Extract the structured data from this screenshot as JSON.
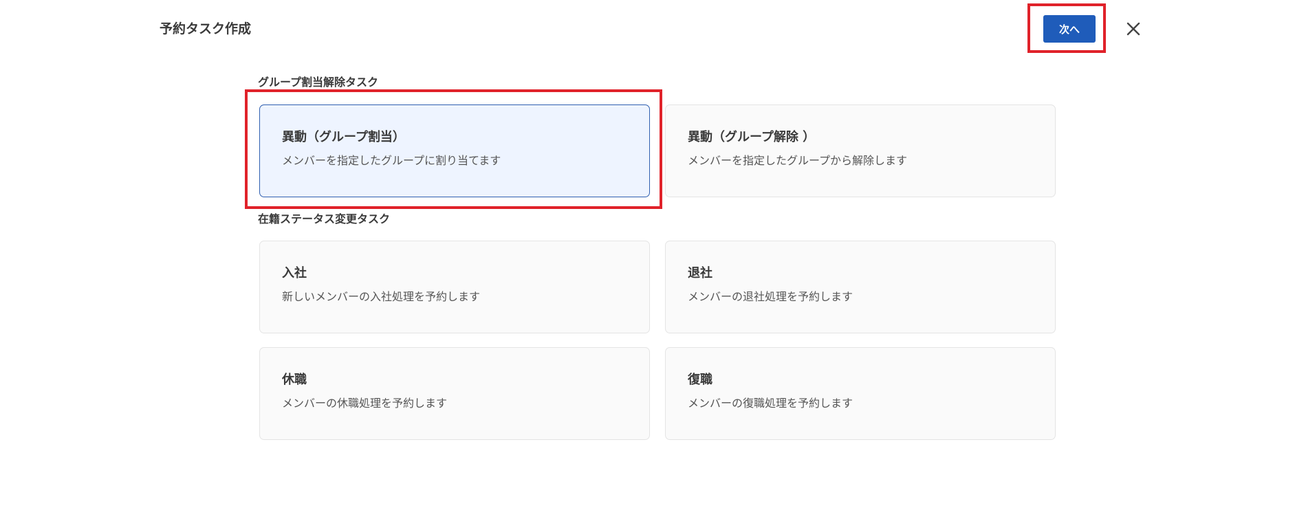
{
  "header": {
    "title": "予約タスク作成",
    "next_label": "次へ",
    "close_icon": "close-icon"
  },
  "sections": [
    {
      "heading": "グループ割当解除タスク",
      "cards": [
        {
          "title": "異動（グループ割当）",
          "description": "メンバーを指定したグループに割り当てます",
          "selected": true
        },
        {
          "title": "異動（グループ解除 ）",
          "description": "メンバーを指定したグループから解除します",
          "selected": false
        }
      ]
    },
    {
      "heading": "在籍ステータス変更タスク",
      "cards": [
        {
          "title": "入社",
          "description": "新しいメンバーの入社処理を予約します",
          "selected": false
        },
        {
          "title": "退社",
          "description": "メンバーの退社処理を予約します",
          "selected": false
        },
        {
          "title": "休職",
          "description": "メンバーの休職処理を予約します",
          "selected": false
        },
        {
          "title": "復職",
          "description": "メンバーの復職処理を予約します",
          "selected": false
        }
      ]
    }
  ],
  "colors": {
    "primary": "#1f5cba",
    "selected_bg": "#eef4ff",
    "selected_border": "#2f5fb0",
    "highlight": "#e0222a"
  }
}
